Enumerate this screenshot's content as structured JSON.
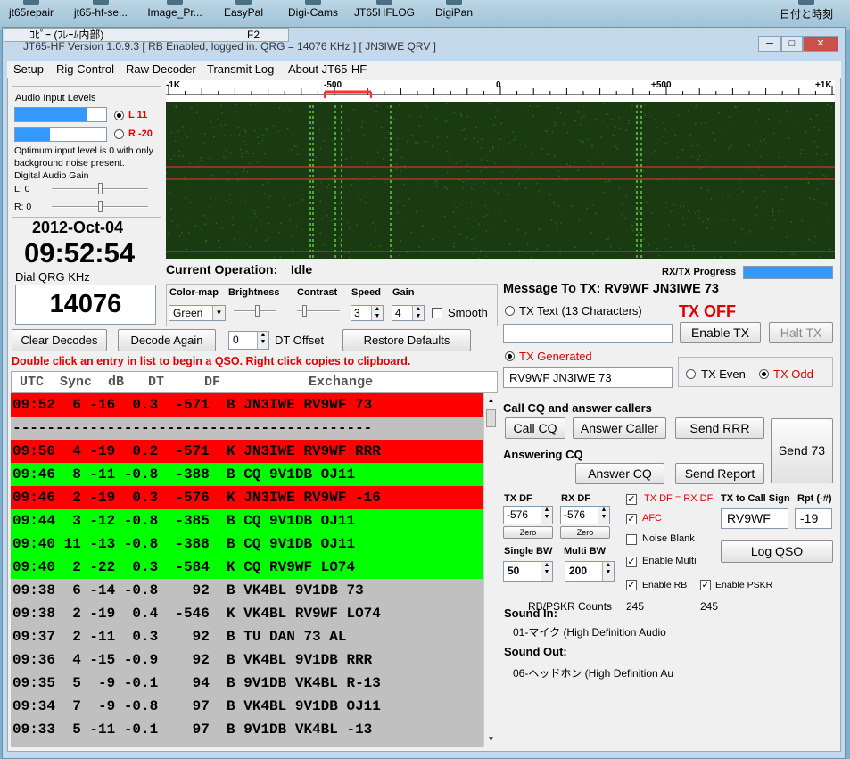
{
  "desktop": {
    "icons": [
      "jt65repair",
      "jt65-hf-se...",
      "Image_Pr...",
      "EasyPal",
      "Digi-Cams",
      "JT65HFLOG",
      "DigiPan"
    ],
    "clock_label": "日付と時刻",
    "tooltip": "ｺﾋﾟｰ (ﾌﾚｰﾑ内部)",
    "tooltip_key": "F2"
  },
  "window": {
    "title": "JT65-HF Version 1.0.9.3  [ RB Enabled, logged in.  QRG = 14076 KHz ] [ JN3IWE QRV ]",
    "min": "─",
    "max": "□",
    "close": "✕"
  },
  "menu": [
    "Setup",
    "Rig Control",
    "Raw Decoder",
    "Transmit Log",
    "About JT65-HF"
  ],
  "audio": {
    "title": "Audio Input Levels",
    "left_label": "L 11",
    "right_label": "R -20",
    "left_level": 0.78,
    "right_level": 0.38,
    "note": "Optimum input level is 0 with only background noise present.",
    "gain_title": "Digital Audio Gain",
    "gain_l": "L: 0",
    "gain_r": "R: 0"
  },
  "date": "2012-Oct-04",
  "time": "09:52:54",
  "qrg_label": "Dial QRG KHz",
  "qrg_value": "14076",
  "waterfall": {
    "ticks": [
      "-1K",
      "-500",
      "0",
      "+500",
      "+1K"
    ],
    "colors": {
      "bg": "#1a3a12",
      "signal": "#7cff5a",
      "marker": "#ff3030"
    }
  },
  "operation": {
    "label": "Current Operation:",
    "value": "Idle"
  },
  "progress_label": "RX/TX Progress",
  "controls": {
    "colormap_label": "Color-map",
    "colormap_value": "Green",
    "brightness_label": "Brightness",
    "contrast_label": "Contrast",
    "speed_label": "Speed",
    "speed_value": "3",
    "gain_label": "Gain",
    "gain_value": "4",
    "smooth_label": "Smooth"
  },
  "buttons": {
    "clear": "Clear Decodes",
    "decode_again": "Decode Again",
    "restore": "Restore Defaults",
    "enable_tx": "Enable TX",
    "halt_tx": "Halt TX",
    "call_cq": "Call CQ",
    "answer_caller": "Answer Caller",
    "send_rrr": "Send RRR",
    "send73": "Send 73",
    "answer_cq": "Answer CQ",
    "send_report": "Send Report",
    "log_qso": "Log QSO",
    "zero_tx": "Zero",
    "zero_rx": "Zero"
  },
  "dt_offset": {
    "value": "0",
    "label": "DT Offset"
  },
  "hint": "Double click an entry in list to begin a QSO.  Right click copies to clipboard.",
  "list_header": " UTC  Sync  dB   DT     DF           Exchange",
  "decodes": [
    {
      "text": "09:52  6 -16  0.3  -571  B JN3IWE RV9WF 73",
      "color": "red"
    },
    {
      "text": "------------------------------------------",
      "color": "dash"
    },
    {
      "text": "09:50  4 -19  0.2  -571  K JN3IWE RV9WF RRR",
      "color": "red"
    },
    {
      "text": "09:46  8 -11 -0.8  -388  B CQ 9V1DB OJ11",
      "color": "green"
    },
    {
      "text": "09:46  2 -19  0.3  -576  K JN3IWE RV9WF -16",
      "color": "red"
    },
    {
      "text": "09:44  3 -12 -0.8  -385  B CQ 9V1DB OJ11",
      "color": "green"
    },
    {
      "text": "09:40 11 -13 -0.8  -388  B CQ 9V1DB OJ11",
      "color": "green"
    },
    {
      "text": "09:40  2 -22  0.3  -584  K CQ RV9WF LO74",
      "color": "green"
    },
    {
      "text": "09:38  6 -14 -0.8    92  B VK4BL 9V1DB 73",
      "color": "gray"
    },
    {
      "text": "09:38  2 -19  0.4  -546  K VK4BL RV9WF LO74",
      "color": "gray"
    },
    {
      "text": "09:37  2 -11  0.3    92  B TU DAN 73 AL",
      "color": "gray"
    },
    {
      "text": "09:36  4 -15 -0.9    92  B VK4BL 9V1DB RRR",
      "color": "gray"
    },
    {
      "text": "09:35  5  -9 -0.1    94  B 9V1DB VK4BL R-13",
      "color": "gray"
    },
    {
      "text": "09:34  7  -9 -0.8    97  B VK4BL 9V1DB OJ11",
      "color": "gray"
    },
    {
      "text": "09:33  5 -11 -0.1    97  B 9V1DB VK4BL -13",
      "color": "gray"
    }
  ],
  "tx": {
    "message_label": "Message To TX: RV9WF JN3IWE 73",
    "tx_text_label": "TX Text (13 Characters)",
    "tx_status": "TX OFF",
    "tx_text_value": "",
    "generated_label": "TX Generated",
    "generated_value": "RV9WF JN3IWE 73",
    "even_label": "TX Even",
    "odd_label": "TX Odd"
  },
  "cq_section": "Call CQ and answer callers",
  "answering_section": "Answering CQ",
  "df": {
    "tx_label": "TX DF",
    "tx_value": "-576",
    "rx_label": "RX DF",
    "rx_value": "-576",
    "single_bw_label": "Single BW",
    "single_bw_value": "50",
    "multi_bw_label": "Multi BW",
    "multi_bw_value": "200"
  },
  "options": {
    "txdf_rxdf": "TX DF = RX DF",
    "afc": "AFC",
    "noise_blank": "Noise Blank",
    "enable_multi": "Enable Multi",
    "enable_rb": "Enable RB",
    "enable_pskr": "Enable PSKR"
  },
  "callsign": {
    "label": "TX to Call Sign",
    "value": "RV9WF",
    "rpt_label": "Rpt (-#)",
    "rpt_value": "-19"
  },
  "rb_counts": {
    "label": "RB/PSKR Counts",
    "rb": "245",
    "pskr": "245"
  },
  "sound": {
    "in_label": "Sound In:",
    "in_device": "01-マイク (High Definition Audio",
    "out_label": "Sound Out:",
    "out_device": "06-ヘッドホン (High Definition Au"
  }
}
